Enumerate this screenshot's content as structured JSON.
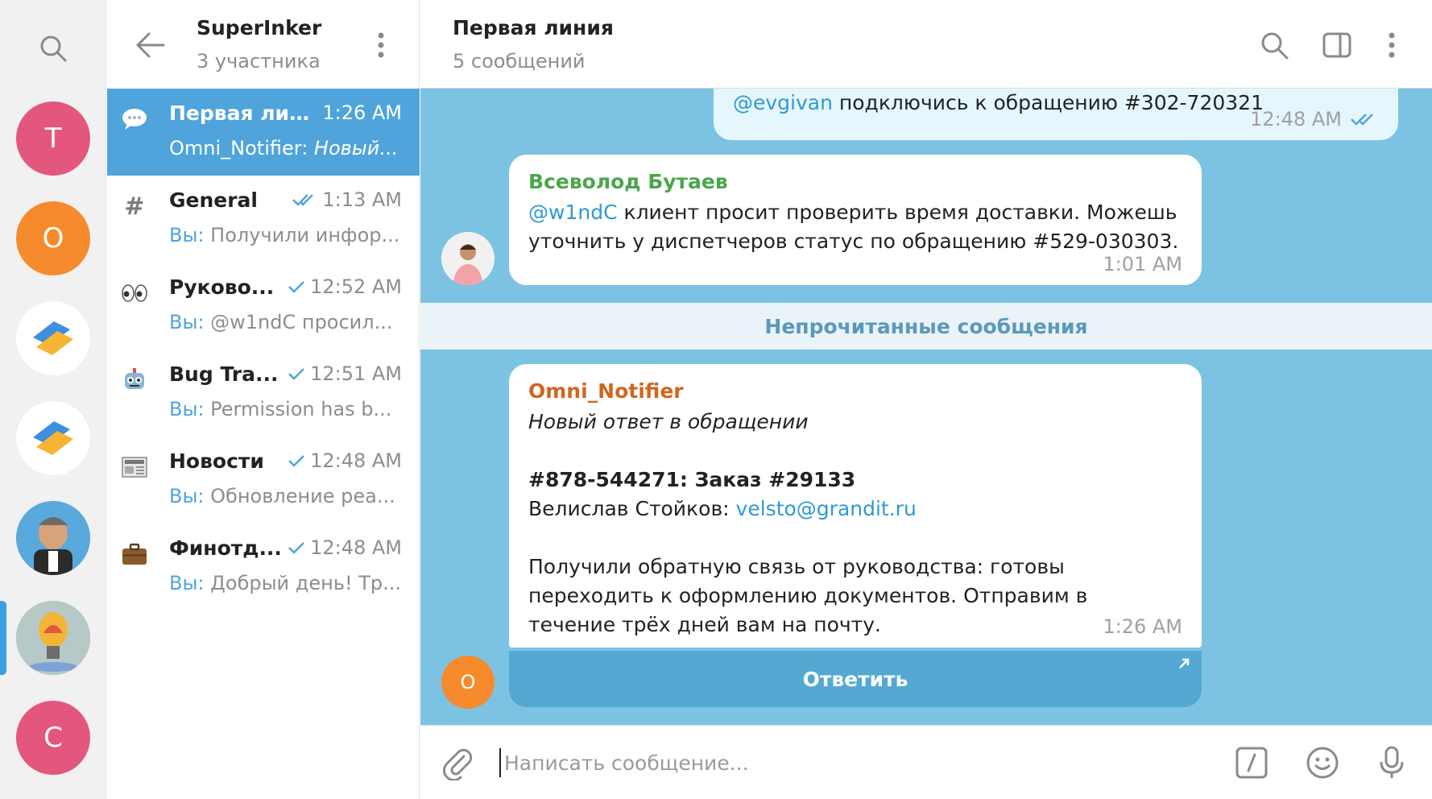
{
  "rail": {
    "folders": [
      {
        "letter": "T",
        "color": "#e3577c"
      },
      {
        "letter": "O",
        "color": "#f58b2c"
      },
      {
        "letter": "",
        "color": "#ffffff"
      },
      {
        "letter": "",
        "color": "#ffffff"
      },
      {
        "letter": "",
        "color": "#4a9fd6"
      },
      {
        "letter": "",
        "color": "#6b8fa0"
      },
      {
        "letter": "C",
        "color": "#e3577c"
      }
    ]
  },
  "group": {
    "title": "SuperInker",
    "subtitle": "3 участника"
  },
  "chats": [
    {
      "emoji": "💬",
      "name": "Первая лин...",
      "time": "1:26 AM",
      "sender": "Omni_Notifier:",
      "preview": "Новый...",
      "active": true
    },
    {
      "emoji": "#",
      "name": "General",
      "time": "1:13 AM",
      "sender": "Вы:",
      "preview": "Получили инфор..."
    },
    {
      "emoji": "👀",
      "name": "Руково...",
      "time": "12:52 AM",
      "sender": "Вы:",
      "preview": "@w1ndC просил..."
    },
    {
      "emoji": "🤖",
      "name": "Bug Tra...",
      "time": "12:51 AM",
      "sender": "Вы:",
      "preview": "Permission has b..."
    },
    {
      "emoji": "📰",
      "name": "Новости",
      "time": "12:48 AM",
      "sender": "Вы:",
      "preview": "Обновление реа..."
    },
    {
      "emoji": "💼",
      "name": "Финотд...",
      "time": "12:48 AM",
      "sender": "Вы:",
      "preview": "Добрый день! Тр..."
    }
  ],
  "conversation": {
    "title": "Первая линия",
    "subtitle": "5 сообщений"
  },
  "messages": {
    "m1": {
      "mention": "@evgivan",
      "text": " подключись к обращению #302-720321",
      "time": "12:48 AM"
    },
    "m2": {
      "sender": "Всеволод Бутаев",
      "mention": "@w1ndC",
      "text": " клиент просит проверить время доставки. Можешь уточнить у диспетчеров статус по обращению #529-030303.",
      "time": "1:01 AM"
    },
    "unread_label": "Непрочитанные сообщения",
    "m3": {
      "sender": "Omni_Notifier",
      "avatar_letter": "O",
      "subject": "Новый ответ в обращении",
      "ticket": "#878-544271: Заказ #29133",
      "contact_name": "Велислав Стойков: ",
      "contact_email": "velsto@grandit.ru",
      "body": "Получили обратную связь от руководства: готовы переходить к оформлению документов. Отправим в течение трёх дней вам на почту.",
      "time": "1:26 AM"
    },
    "reply_label": "Ответить"
  },
  "composer": {
    "placeholder": "Написать сообщение..."
  },
  "colors": {
    "accent": "#4fa4dc",
    "chat_bg": "#7cc3e3",
    "sender_green": "#4aa64a",
    "sender_orange": "#d0661f"
  }
}
